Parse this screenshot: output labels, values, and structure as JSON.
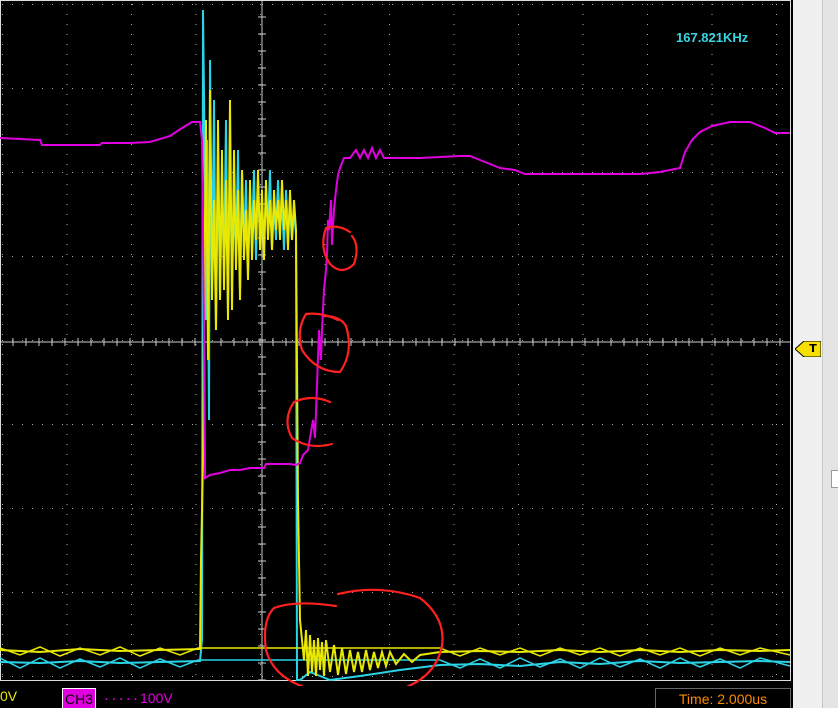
{
  "scope": {
    "frequency_readout": "167.821KHz",
    "trigger_marker": "T",
    "colors": {
      "ch1": "#e8e800",
      "ch2": "#2ad4e6",
      "ch3": "#e000e0",
      "annotation": "#ff2020",
      "grid": "#ffffff"
    }
  },
  "status_bar": {
    "ch1_volts": "0V",
    "ch3_label": "CH3",
    "ch3_coupling": ".....",
    "ch3_volts": "100V",
    "timebase": "Time: 2.000us"
  }
}
